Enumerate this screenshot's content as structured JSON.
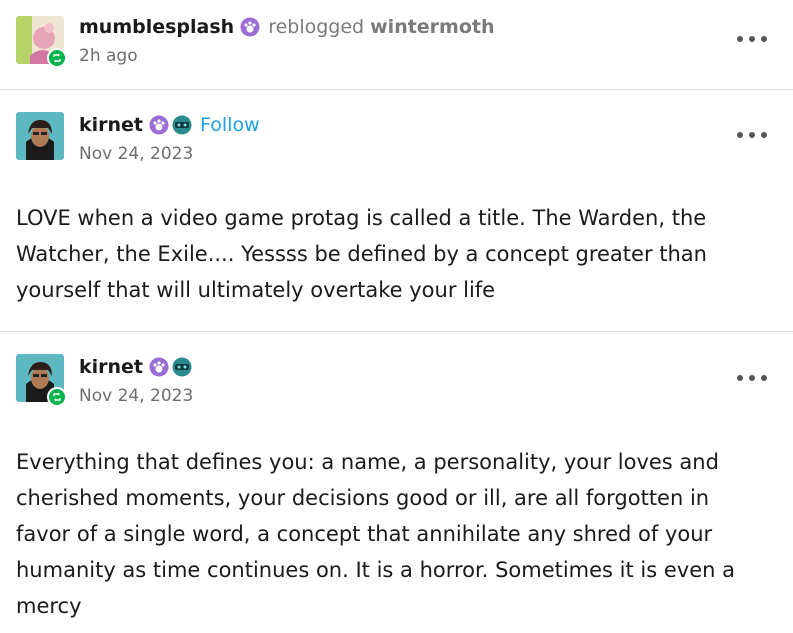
{
  "reblog_header": {
    "username": "mumblesplash",
    "action": "reblogged",
    "target": "wintermoth",
    "timestamp": "2h ago"
  },
  "post1": {
    "username": "kirnet",
    "follow_label": "Follow",
    "timestamp": "Nov 24, 2023",
    "body": "LOVE when a video game protag is called a title. The Warden, the Watcher, the Exile.... Yessss be defined by a concept greater than yourself that will ultimately overtake your life"
  },
  "post2": {
    "username": "kirnet",
    "timestamp": "Nov 24, 2023",
    "body": "Everything that defines you: a name, a personality, your loves and cherished moments, your decisions good or ill, are all forgotten in favor of a single word, a concept that annihilate any shred of your humanity as time continues on. It is a horror. Sometimes it is even a mercy"
  },
  "colors": {
    "follow": "#1da1e6",
    "reblog_badge": "#00b34a",
    "badge_purple": "#9b6bd6",
    "badge_teal": "#2b8a8e"
  }
}
